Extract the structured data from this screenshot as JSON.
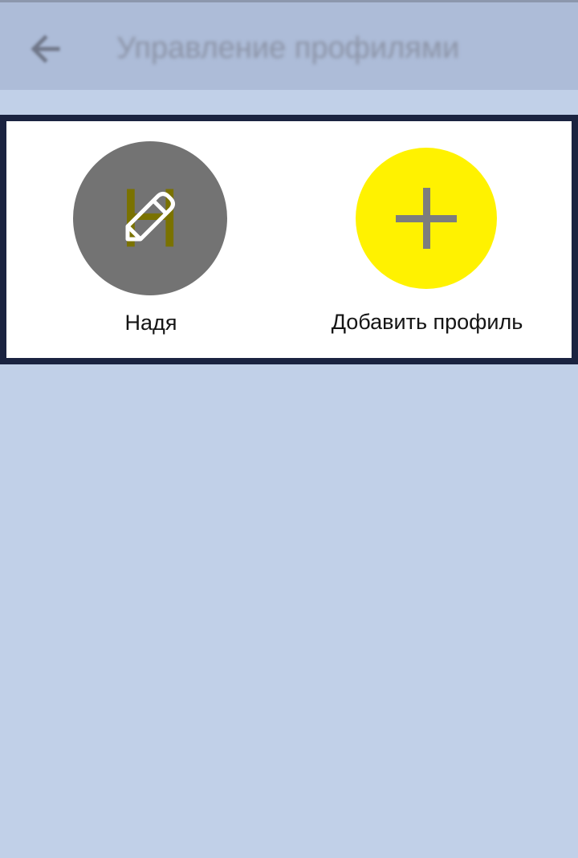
{
  "header": {
    "back_icon": "arrow-left-icon",
    "title": "Управление профилями"
  },
  "profiles": [
    {
      "initial": "Н",
      "name": "Надя",
      "avatar_color": "#737373",
      "initial_color": "#7a7200",
      "overlay_icon": "pencil-icon"
    }
  ],
  "add_profile": {
    "label": "Добавить профиль",
    "icon": "plus-icon",
    "circle_color": "#fff200"
  },
  "colors": {
    "background": "#c1d0e8",
    "appbar": "#adbcd8",
    "panel_border": "#1a2340"
  }
}
